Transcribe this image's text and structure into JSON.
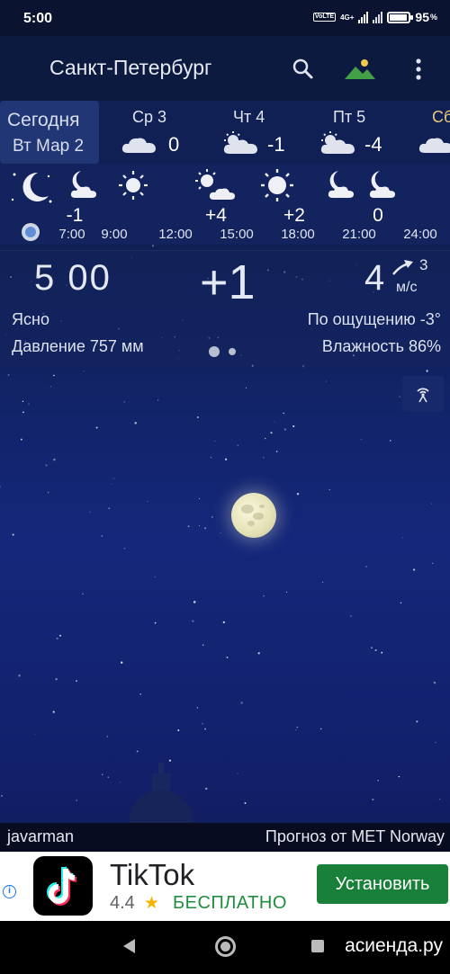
{
  "status": {
    "time": "5:00",
    "network": "4G+",
    "volte": "VoLTE",
    "battery_level": 0.95,
    "battery_label": "95",
    "battery_suffix": "%"
  },
  "header": {
    "city": "Санкт-Петербург",
    "search_icon": "search-icon",
    "wallpaper_icon": "landscape-icon",
    "menu_icon": "more-vert-icon"
  },
  "days": {
    "today": {
      "name": "Сегодня",
      "date": "Вт Мар 2"
    },
    "items": [
      {
        "name": "Ср 3",
        "temp": "0",
        "icon": "partly-cloudy-icon"
      },
      {
        "name": "Чт 4",
        "temp": "-1",
        "icon": "partly-cloudy-sun-icon"
      },
      {
        "name": "Пт 5",
        "temp": "-4",
        "icon": "partly-cloudy-sun-icon"
      },
      {
        "name": "Сб",
        "temp": "",
        "icon": "cloud-icon"
      }
    ]
  },
  "hourly": {
    "times": [
      "7:00",
      "9:00",
      "12:00",
      "15:00",
      "18:00",
      "21:00",
      "24:00"
    ],
    "temps": [
      "-1",
      "+4",
      "+2",
      "0"
    ]
  },
  "now": {
    "time": "5 00",
    "temp": "+1",
    "wind_speed": "4",
    "wind_gust": "3",
    "wind_unit": "м/с",
    "condition": "Ясно",
    "feels_like": "По ощущению -3°",
    "pressure": "Давление 757 мм",
    "humidity": "Влажность 86%"
  },
  "credits": {
    "user": "javarman",
    "source": "Прогноз от MET Norway"
  },
  "ad": {
    "app": "TikTok",
    "rating": "4.4",
    "price": "БЕСПЛАТНО",
    "button": "Установить",
    "info_icon": "info-icon"
  },
  "watermark": "асиенда.ру",
  "colors": {
    "install_button": "#188038",
    "free_text": "#1e8e3e",
    "sky_top": "#0b1533",
    "sky_mid": "#14277a"
  }
}
